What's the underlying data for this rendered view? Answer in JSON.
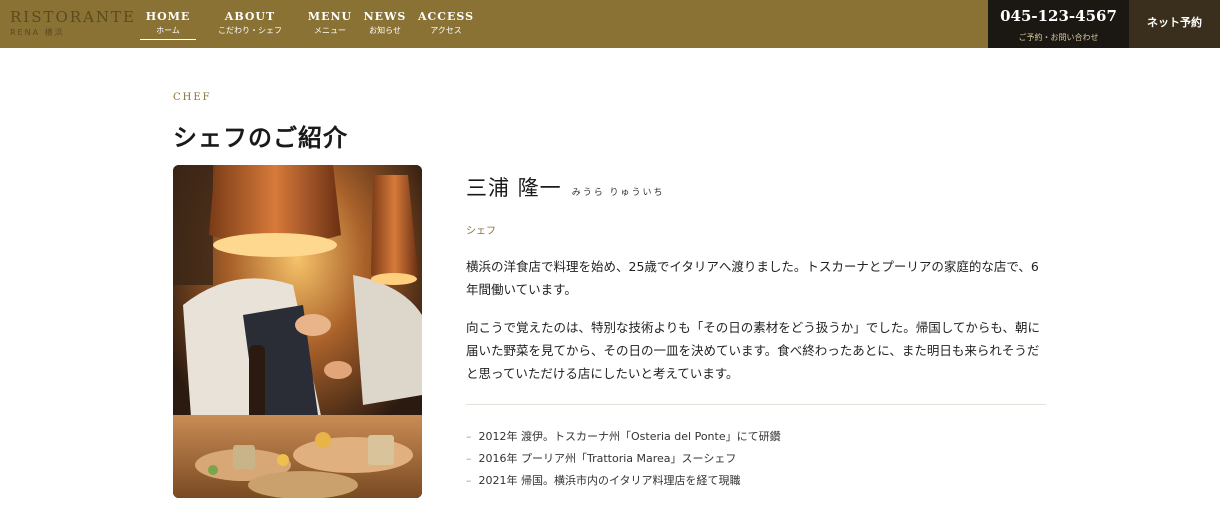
{
  "header": {
    "logo_main": "RISTORANTE",
    "logo_sub": "RENA 横浜",
    "nav": [
      {
        "en": "HOME",
        "jp": "ホーム",
        "active": true
      },
      {
        "en": "ABOUT",
        "jp": "こだわり・シェフ"
      },
      {
        "en": "MENU",
        "jp": "メニュー"
      },
      {
        "en": "NEWS",
        "jp": "お知らせ"
      },
      {
        "en": "ACCESS",
        "jp": "アクセス"
      }
    ],
    "phone": "045-123-4567",
    "phone_sub": "ご予約・お問い合わせ",
    "reserve_label": "ネット予約"
  },
  "section": {
    "eyebrow": "CHEF",
    "title": "シェフのご紹介"
  },
  "chef": {
    "name": "三浦 隆一",
    "kana": "みうら りゅういち",
    "role": "シェフ",
    "paragraphs": [
      "横浜の洋食店で料理を始め、25歳でイタリアへ渡りました。トスカーナとプーリアの家庭的な店で、6年間働いています。",
      "向こうで覚えたのは、特別な技術よりも「その日の素材をどう扱うか」でした。帰国してからも、朝に届いた野菜を見てから、その日の一皿を決めています。食べ終わったあとに、また明日も来られそうだと思っていただける店にしたいと考えています。"
    ],
    "timeline": [
      "2012年 渡伊。トスカーナ州「Osteria del Ponte」にて研鑽",
      "2016年 プーリア州「Trattoria Marea」スーシェフ",
      "2021年 帰国。横浜市内のイタリア料理店を経て現職"
    ]
  },
  "colors": {
    "header_bg": "#8a7235",
    "accent": "#8a7235",
    "phone_bg": "#1b1712",
    "reserve_bg": "#3a2f1d"
  }
}
